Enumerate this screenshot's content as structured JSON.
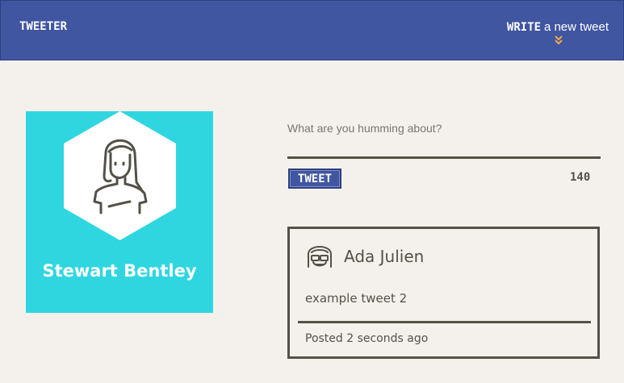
{
  "nav": {
    "brand": "TWEETER",
    "compose_strong": "WRITE",
    "compose_light": "a new tweet",
    "compose_icon": "chevron-double-down-icon",
    "accent_color": "#f0a84b",
    "background_color": "#4056a1"
  },
  "profile": {
    "name": "Stewart Bentley",
    "avatar_icon": "woman-avatar-icon",
    "background_color": "#2fd6e0"
  },
  "composer": {
    "placeholder": "What are you humming about?",
    "submit_label": "TWEET",
    "counter": "140"
  },
  "tweets": [
    {
      "author": "Ada Julien",
      "avatar_icon": "glasses-avatar-icon",
      "text": "example tweet 2",
      "posted": "Posted 2 seconds ago"
    }
  ]
}
